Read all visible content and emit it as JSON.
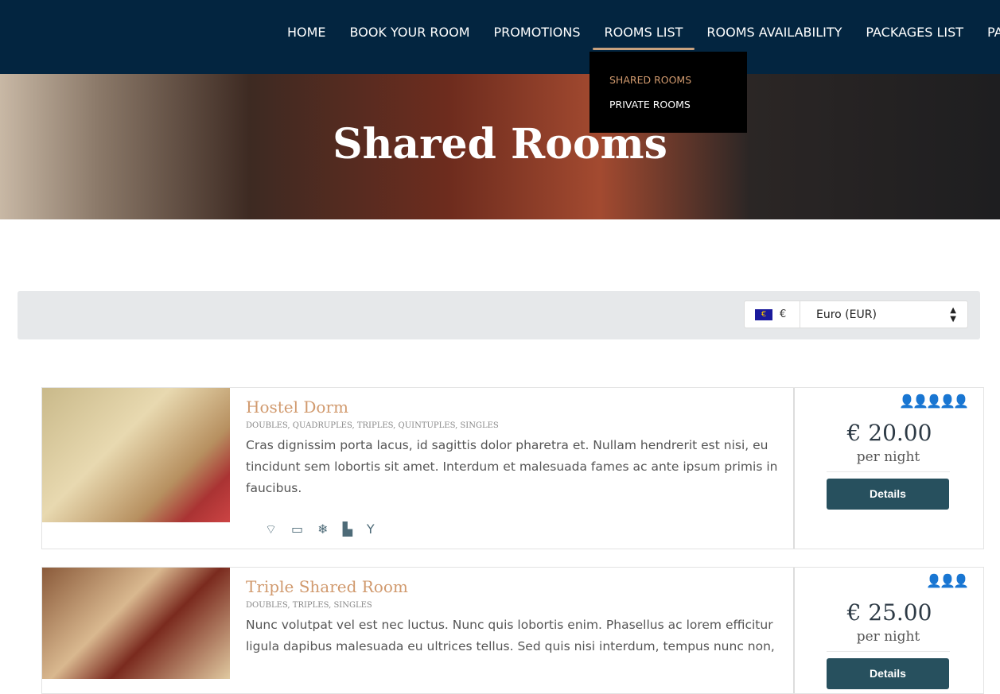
{
  "nav": {
    "items": [
      "HOME",
      "BOOK YOUR ROOM",
      "PROMOTIONS",
      "ROOMS LIST",
      "ROOMS AVAILABILITY",
      "PACKAGES LIST",
      "PACKAGES"
    ],
    "active": "ROOMS LIST",
    "dropdown": [
      "SHARED ROOMS",
      "PRIVATE ROOMS"
    ]
  },
  "hero": {
    "title": "Shared Rooms"
  },
  "currency": {
    "symbol": "€",
    "flag": "€",
    "selected": "Euro (EUR)"
  },
  "colors": {
    "nav": "#032540",
    "accent": "#d19a6e",
    "button": "#27505e"
  },
  "rooms": [
    {
      "title": "Hostel Dorm",
      "types": "DOUBLES, QUADRUPLES, TRIPLES, QUINTUPLES, SINGLES",
      "desc": "Cras dignissim porta lacus, id sagittis dolor pharetra et. Nullam hendrerit est nisi, eu tincidunt sem lobortis sit amet. Interdum et malesuada fames ac ante ipsum primis in faucibus.",
      "price": "€ 20.00",
      "per": "per night",
      "button": "Details",
      "capacity": 5,
      "amenities": [
        "wifi-icon",
        "tv-icon",
        "air-conditioning-icon",
        "bathtub-icon",
        "bar-icon"
      ]
    },
    {
      "title": "Triple Shared Room",
      "types": "DOUBLES, TRIPLES, SINGLES",
      "desc": "Nunc volutpat vel est nec luctus. Nunc quis lobortis enim. Phasellus ac lorem efficitur ligula dapibus malesuada eu ultrices tellus. Sed quis nisi interdum, tempus nunc non,",
      "price": "€ 25.00",
      "per": "per night",
      "button": "Details",
      "capacity": 3
    }
  ]
}
